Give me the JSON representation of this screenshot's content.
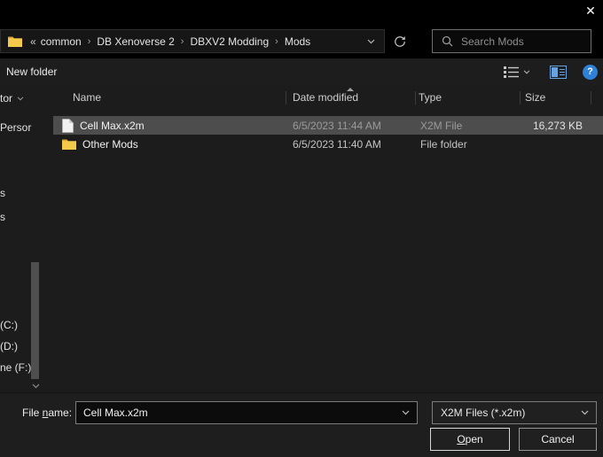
{
  "window": {
    "close_glyph": "✕"
  },
  "colors": {
    "selection": "#4d4d4d",
    "folder_yellow": "#f3c84b",
    "help_blue": "#2f80d8",
    "pane_blue": "#69a1dc"
  },
  "address_bar": {
    "overflow_glyph": "«",
    "crumb_sep": "›",
    "crumbs": [
      "common",
      "DB Xenoverse 2",
      "DBXV2 Modding",
      "Mods"
    ],
    "search_placeholder": "Search Mods"
  },
  "toolbar": {
    "new_folder": "New folder",
    "help_glyph": "?"
  },
  "sidebar": {
    "items": [
      {
        "label": "tor"
      },
      {
        "label": "Persor"
      },
      {
        "label": "s"
      },
      {
        "label": "s"
      },
      {
        "label": "(C:)"
      },
      {
        "label": "(D:)"
      },
      {
        "label": "ne (F:)"
      }
    ]
  },
  "file_list": {
    "columns": [
      {
        "label": "Name"
      },
      {
        "label": "Date modified"
      },
      {
        "label": "Type"
      },
      {
        "label": "Size"
      }
    ],
    "rows": [
      {
        "name": "Cell Max.x2m",
        "date_modified": "6/5/2023 11:44 AM",
        "type": "X2M File",
        "size": "16,273 KB"
      },
      {
        "name": "Other Mods",
        "date_modified": "6/5/2023 11:40 AM",
        "type": "File folder",
        "size": ""
      }
    ]
  },
  "footer": {
    "file_name_label": {
      "pre": "File ",
      "accel": "n",
      "post": "ame:"
    },
    "file_name_value": "Cell Max.x2m",
    "file_type_value": "X2M Files (*.x2m)",
    "open_button": {
      "accel": "O",
      "post": "pen"
    },
    "cancel_button": "Cancel"
  }
}
